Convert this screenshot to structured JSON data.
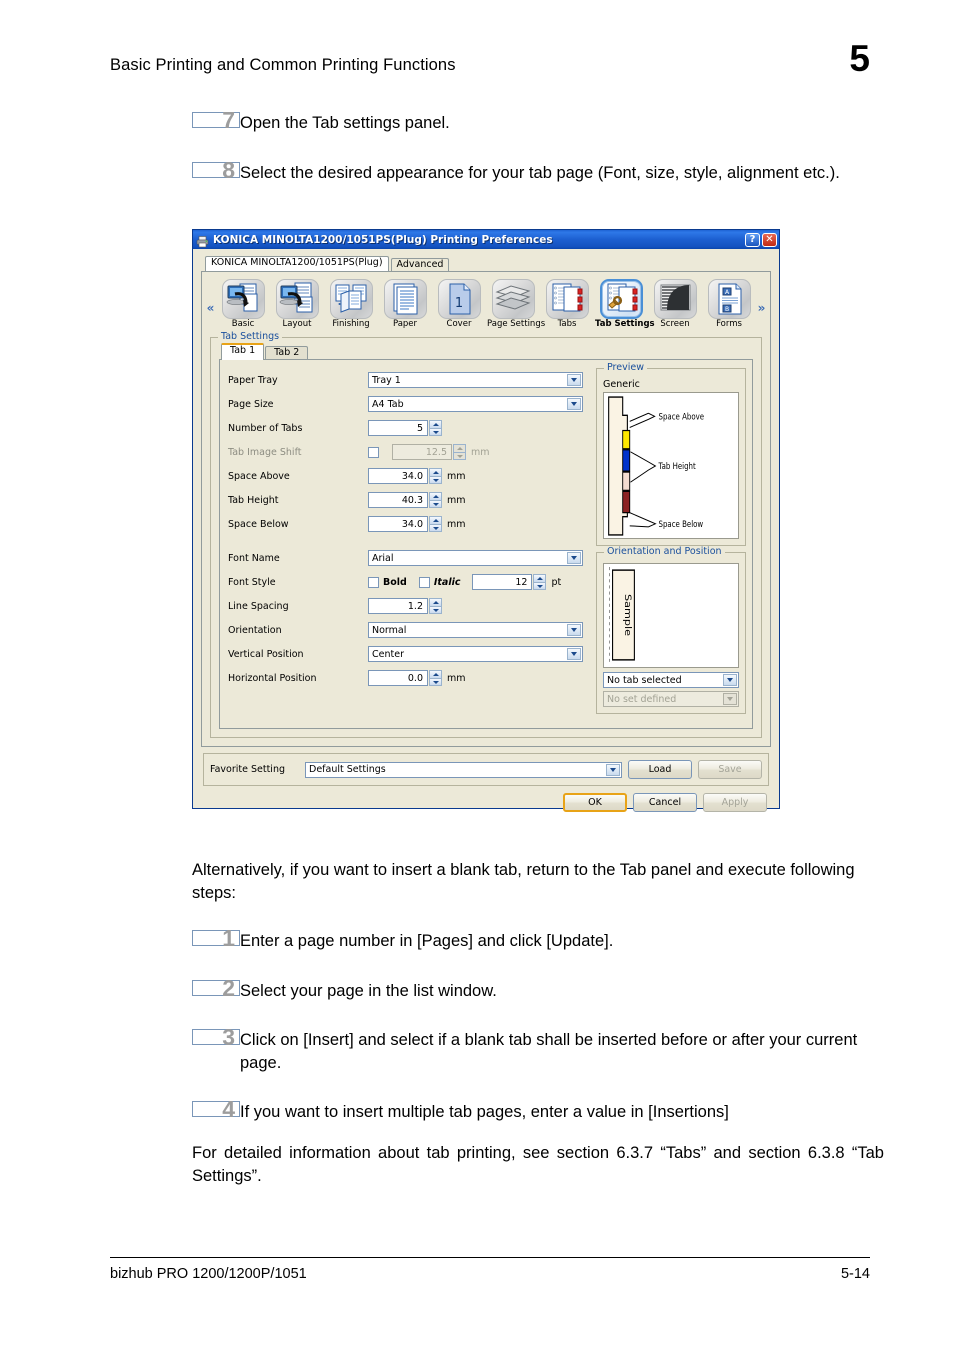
{
  "header": {
    "title": "Basic Printing and Common Printing Functions",
    "chapter": "5"
  },
  "steps_top": [
    {
      "num": "7",
      "text": "Open the Tab settings panel."
    },
    {
      "num": "8",
      "text": "Select the desired appearance for your tab page (Font, size, style, alignment etc.)."
    }
  ],
  "dialog": {
    "title": "KONICA MINOLTA1200/1051PS(Plug) Printing Preferences",
    "titlebar_icon": "printer-icon",
    "help_button": "?",
    "close_button": "✕",
    "top_tabs": [
      {
        "label": "KONICA MINOLTA1200/1051PS(Plug)",
        "active": true
      },
      {
        "label": "Advanced",
        "active": false
      }
    ],
    "nav_prev": "«",
    "nav_next": "»",
    "icons": [
      {
        "label": "Basic",
        "icon": "basic-icon",
        "selected": false
      },
      {
        "label": "Layout",
        "icon": "layout-icon",
        "selected": false
      },
      {
        "label": "Finishing",
        "icon": "finishing-icon",
        "selected": false
      },
      {
        "label": "Paper",
        "icon": "paper-icon",
        "selected": false
      },
      {
        "label": "Cover",
        "icon": "cover-icon",
        "selected": false
      },
      {
        "label": "Page Settings",
        "icon": "page-settings-icon",
        "selected": false
      },
      {
        "label": "Tabs",
        "icon": "tabs-icon",
        "selected": false
      },
      {
        "label": "Tab Settings",
        "icon": "tab-settings-icon",
        "selected": true
      },
      {
        "label": "Screen",
        "icon": "screen-icon",
        "selected": false
      },
      {
        "label": "Forms",
        "icon": "forms-icon",
        "selected": false
      }
    ],
    "group_label": "Tab Settings",
    "sub_tabs": [
      {
        "label": "Tab 1",
        "active": true
      },
      {
        "label": "Tab 2",
        "active": false
      }
    ],
    "fields": {
      "paper_tray_label": "Paper Tray",
      "paper_tray_value": "Tray 1",
      "page_size_label": "Page Size",
      "page_size_value": "A4 Tab",
      "number_of_tabs_label": "Number of Tabs",
      "number_of_tabs_value": "5",
      "tab_image_shift_label": "Tab Image Shift",
      "tab_image_shift_value": "12.5",
      "tab_image_shift_unit": "mm",
      "space_above_label": "Space Above",
      "space_above_value": "34.0",
      "space_above_unit": "mm",
      "tab_height_label": "Tab Height",
      "tab_height_value": "40.3",
      "tab_height_unit": "mm",
      "space_below_label": "Space Below",
      "space_below_value": "34.0",
      "space_below_unit": "mm",
      "font_name_label": "Font Name",
      "font_name_value": "Arial",
      "font_style_label": "Font Style",
      "bold_label": "Bold",
      "italic_label": "Italic",
      "font_size_value": "12",
      "font_size_unit": "pt",
      "line_spacing_label": "Line Spacing",
      "line_spacing_value": "1.2",
      "orientation_label": "Orientation",
      "orientation_value": "Normal",
      "vertical_position_label": "Vertical Position",
      "vertical_position_value": "Center",
      "horizontal_position_label": "Horizontal Position",
      "horizontal_position_value": "0.0",
      "horizontal_position_unit": "mm"
    },
    "preview": {
      "group_label": "Preview",
      "generic_label": "Generic",
      "callouts": [
        "Space Above",
        "Tab Height",
        "Space Below"
      ],
      "tab_colors": [
        "#FFE800",
        "#0033CC",
        "#F3DCD0",
        "#8B2222"
      ]
    },
    "orientation_panel": {
      "group_label": "Orientation and Position",
      "sample_text": "Sample",
      "tab_select_value": "No tab selected",
      "set_select_value": "No set defined"
    },
    "bottom": {
      "favorite_label": "Favorite Setting",
      "favorite_value": "Default Settings",
      "load_label": "Load",
      "save_label": "Save",
      "ok_label": "OK",
      "cancel_label": "Cancel",
      "apply_label": "Apply"
    }
  },
  "body": {
    "alt_paragraph": "Alternatively, if you want to insert a blank tab, return to the Tab panel and execute following steps:",
    "closing_paragraph": "For detailed information about tab printing, see section 6.3.7 “Tabs” and section 6.3.8 “Tab Settings”."
  },
  "steps_bottom": [
    {
      "num": "1",
      "text": "Enter a page number in [Pages] and click [Update]."
    },
    {
      "num": "2",
      "text": "Select your page in the list window."
    },
    {
      "num": "3",
      "text": "Click on [Insert] and select if a blank tab shall be inserted before or after your current page."
    },
    {
      "num": "4",
      "text": "If you want to insert multiple tab pages, enter a value in [Insertions]"
    }
  ],
  "footer": {
    "left": "bizhub PRO 1200/1200P/1051",
    "right": "5-14"
  }
}
